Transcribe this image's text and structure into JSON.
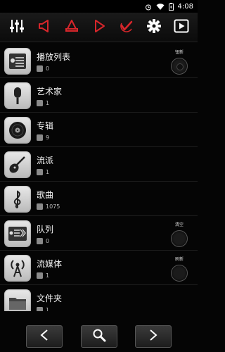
{
  "status_bar": {
    "time": "4:08",
    "icons": [
      "alarm-icon",
      "wifi-icon",
      "battery-icon"
    ]
  },
  "toolbar": {
    "buttons": [
      "equalizer-icon",
      "volume-left-icon",
      "bell-icon",
      "volume-right-icon",
      "check-icon",
      "gear-icon",
      "play-icon"
    ],
    "accent_color": "#d8262b"
  },
  "library": {
    "items": [
      {
        "title": "播放列表",
        "count": "0",
        "icon": "playlist-icon",
        "side_label": "钮新"
      },
      {
        "title": "艺术家",
        "count": "1",
        "icon": "microphone-icon"
      },
      {
        "title": "专辑",
        "count": "9",
        "icon": "vinyl-disc-icon"
      },
      {
        "title": "流派",
        "count": "1",
        "icon": "guitar-icon"
      },
      {
        "title": "歌曲",
        "count": "1075",
        "icon": "treble-clef-icon"
      },
      {
        "title": "队列",
        "count": "0",
        "icon": "queue-icon",
        "side_label": "清空"
      },
      {
        "title": "流媒体",
        "count": "1",
        "icon": "broadcast-icon",
        "side_label": "刷新"
      },
      {
        "title": "文件夹",
        "count": "1",
        "icon": "folder-icon"
      },
      {
        "title": "",
        "count": "",
        "icon": "partial-item-icon"
      }
    ]
  },
  "bottom_nav": {
    "buttons": [
      "previous-icon",
      "search-icon",
      "next-icon"
    ]
  }
}
